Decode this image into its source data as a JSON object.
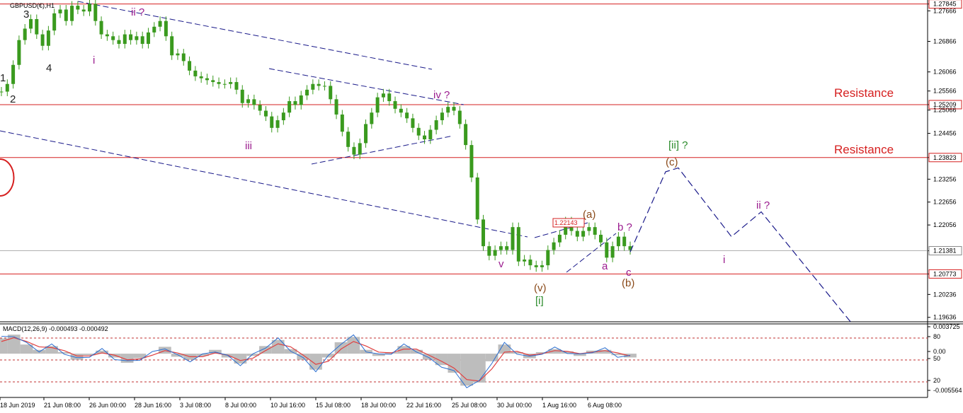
{
  "window": {
    "symbol_label": "GBPUSD(€),H1"
  },
  "colors": {
    "candle": "#3a9a1e",
    "trend_line": "#1a1a8a",
    "resistance": "#d62020",
    "current_price": "#b0b0b0",
    "forecast": "#1a1a8a",
    "purple": "#9b1c8f",
    "brown": "#8a4a1a",
    "green": "#2a8a2a",
    "macd_hist": "#bdbdbd",
    "macd_signal": "#e04040",
    "macd_blue": "#2a6ed0"
  },
  "chart_data": [
    {
      "type": "line",
      "title": "GBPUSD(€),H1",
      "ylim": [
        1.1952,
        1.2795
      ],
      "y_ticks": [
        "1.27845",
        "1.27666",
        "1.26866",
        "1.26066",
        "1.25566",
        "1.25209",
        "1.25066",
        "1.24456",
        "1.23823",
        "1.23256",
        "1.22656",
        "1.22056",
        "1.21381",
        "1.20773",
        "1.20236",
        "1.19636"
      ],
      "x_ticks": [
        "18 Jun 2019",
        "21 Jun 08:00",
        "26 Jun 00:00",
        "28 Jun 16:00",
        "3 Jul 08:00",
        "8 Jul 00:00",
        "10 Jul 16:00",
        "15 Jul 08:00",
        "18 Jul 00:00",
        "22 Jul 16:00",
        "25 Jul 08:00",
        "30 Jul 00:00",
        "1 Aug 16:00",
        "6 Aug 08:00"
      ],
      "series": [
        {
          "values": [
            1.2555,
            1.2575,
            1.2625,
            1.269,
            1.272,
            1.2745,
            1.2705,
            1.2675,
            1.2715,
            1.276,
            1.277,
            1.274,
            1.278,
            1.277,
            1.2765,
            1.2785,
            1.274,
            1.2705,
            1.27,
            1.269,
            1.268,
            1.2705,
            1.269,
            1.27,
            1.268,
            1.271,
            1.2725,
            1.274,
            1.27,
            1.265,
            1.2655,
            1.2635,
            1.261,
            1.2595,
            1.259,
            1.2585,
            1.258,
            1.2575,
            1.2575,
            1.258,
            1.256,
            1.2525,
            1.2535,
            1.252,
            1.2505,
            1.249,
            1.246,
            1.248,
            1.25,
            1.253,
            1.252,
            1.2545,
            1.256,
            1.2575,
            1.257,
            1.257,
            1.2535,
            1.2495,
            1.245,
            1.241,
            1.239,
            1.242,
            1.247,
            1.25,
            1.254,
            1.255,
            1.253,
            1.251,
            1.25,
            1.2485,
            1.246,
            1.244,
            1.243,
            1.2455,
            1.248,
            1.25,
            1.2515,
            1.2505,
            1.247,
            1.2415,
            1.233,
            1.222,
            1.215,
            1.2125,
            1.214,
            1.215,
            1.214,
            1.22,
            1.211,
            1.2115,
            1.21,
            1.2095,
            1.21,
            1.214,
            1.216,
            1.218,
            1.2215,
            1.219,
            1.2175,
            1.219,
            1.22,
            1.218,
            1.216,
            1.212,
            1.215,
            1.2175,
            1.215,
            1.214
          ]
        }
      ],
      "current_price": 1.21381,
      "box_label": "1.22143",
      "resistance": [
        {
          "level": 1.27845,
          "price_label": "1.27845",
          "text": ""
        },
        {
          "level": 1.25209,
          "price_label": "1.25209",
          "text": "Resistance"
        },
        {
          "level": 1.23823,
          "price_label": "1.23823",
          "text": "Resistance"
        },
        {
          "level": 1.20773,
          "price_label": "1.20773",
          "text": ""
        }
      ],
      "forecast_path": [
        [
          1.2135,
          1.217
        ],
        [
          1.2345,
          1.2355
        ],
        [
          1.2145,
          1.2175
        ],
        [
          1.223,
          1.224
        ],
        [
          1.196,
          1.195
        ]
      ],
      "wave_labels": [
        {
          "text": "1",
          "color": "dark"
        },
        {
          "text": "2",
          "color": "dark"
        },
        {
          "text": "3",
          "color": "dark"
        },
        {
          "text": "4",
          "color": "dark"
        },
        {
          "text": "i",
          "color": "purple"
        },
        {
          "text": "ii ?",
          "color": "purple"
        },
        {
          "text": "iii",
          "color": "purple"
        },
        {
          "text": "iv ?",
          "color": "purple"
        },
        {
          "text": "v",
          "color": "purple"
        },
        {
          "text": "(v)",
          "color": "brown"
        },
        {
          "text": "[i]",
          "color": "green"
        },
        {
          "text": "(a)",
          "color": "brown"
        },
        {
          "text": "a",
          "color": "purple"
        },
        {
          "text": "b ?",
          "color": "purple"
        },
        {
          "text": "c",
          "color": "purple"
        },
        {
          "text": "(b)",
          "color": "brown"
        },
        {
          "text": "[ii] ?",
          "color": "green"
        },
        {
          "text": "(c)",
          "color": "brown"
        },
        {
          "text": "i",
          "color": "purple"
        },
        {
          "text": "ii ?",
          "color": "purple"
        }
      ]
    },
    {
      "type": "line",
      "title": "MACD(12,26,9) -0.000493 -0.000492",
      "y_ticks": [
        "0.003725",
        "80",
        "0.00",
        "50",
        "20",
        "-0.005564"
      ],
      "series": [
        {
          "name": "MACD",
          "values": [
            0.002,
            0.0025,
            0.0012,
            0.0005,
            0.001,
            0.0002,
            -0.0008,
            -0.0002,
            0.0004,
            -0.0005,
            -0.0012,
            -0.0006,
            0.0,
            0.0009,
            -0.0004,
            -0.0008,
            -0.0003,
            0.0005,
            -0.0005,
            -0.0013,
            -0.0003,
            0.001,
            0.0018,
            0.0006,
            -0.0008,
            -0.0021,
            -0.0005,
            0.0015,
            0.0022,
            0.0005,
            -0.0003,
            0.0002,
            0.001,
            0.0005,
            -0.0008,
            -0.0015,
            -0.0025,
            -0.0042,
            -0.0038,
            -0.001,
            0.0012,
            0.0002,
            -0.0006,
            0.0002,
            0.0006,
            0.0003,
            -0.0003,
            0.0004,
            0.0005,
            -0.0002,
            -0.0005
          ]
        },
        {
          "name": "Signal",
          "values": [
            0.0016,
            0.0021,
            0.0016,
            0.0009,
            0.0008,
            0.0004,
            -0.0003,
            -0.0003,
            0.0001,
            -0.0002,
            -0.0008,
            -0.0007,
            -0.0002,
            0.0004,
            0.0001,
            -0.0004,
            -0.0004,
            0.0001,
            -0.0002,
            -0.0009,
            -0.0006,
            0.0004,
            0.0013,
            0.0009,
            -0.0002,
            -0.0014,
            -0.001,
            0.0006,
            0.0016,
            0.001,
            0.0002,
            0.0001,
            0.0006,
            0.0006,
            -0.0002,
            -0.001,
            -0.0019,
            -0.0034,
            -0.0036,
            -0.002,
            0.0002,
            0.0003,
            -0.0002,
            0.0,
            0.0004,
            0.0003,
            0.0,
            0.0002,
            0.0004,
            0.0001,
            -0.0003
          ]
        }
      ]
    }
  ]
}
